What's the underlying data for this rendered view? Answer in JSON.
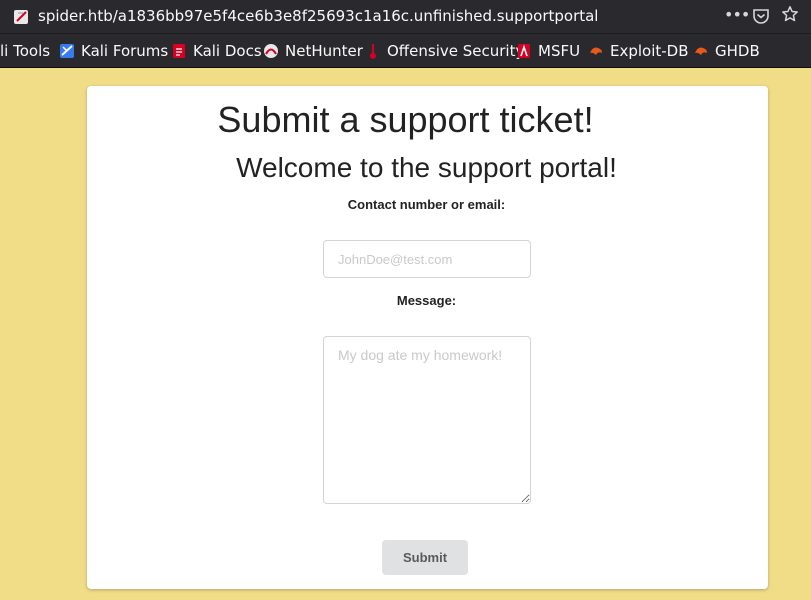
{
  "browser": {
    "url": "spider.htb/a1836bb97e5f4ce6b3e8f25693c1a16c.unfinished.supportportal",
    "bookmarks": [
      {
        "label": "li Tools"
      },
      {
        "label": "Kali Forums"
      },
      {
        "label": "Kali Docs"
      },
      {
        "label": "NetHunter"
      },
      {
        "label": "Offensive Security"
      },
      {
        "label": "MSFU"
      },
      {
        "label": "Exploit-DB"
      },
      {
        "label": "GHDB"
      }
    ],
    "more_label": "•••"
  },
  "page": {
    "title": "Submit a support ticket!",
    "subtitle": "Welcome to the support portal!",
    "contact_label": "Contact number or email:",
    "contact_placeholder": "JohnDoe@test.com",
    "message_label": "Message:",
    "message_placeholder": "My dog ate my homework!",
    "submit_label": "Submit"
  },
  "colors": {
    "page_background": "#f1dc88",
    "card_background": "#ffffff",
    "button_background": "#e0e1e2",
    "chrome_background": "#2a2a2e"
  }
}
